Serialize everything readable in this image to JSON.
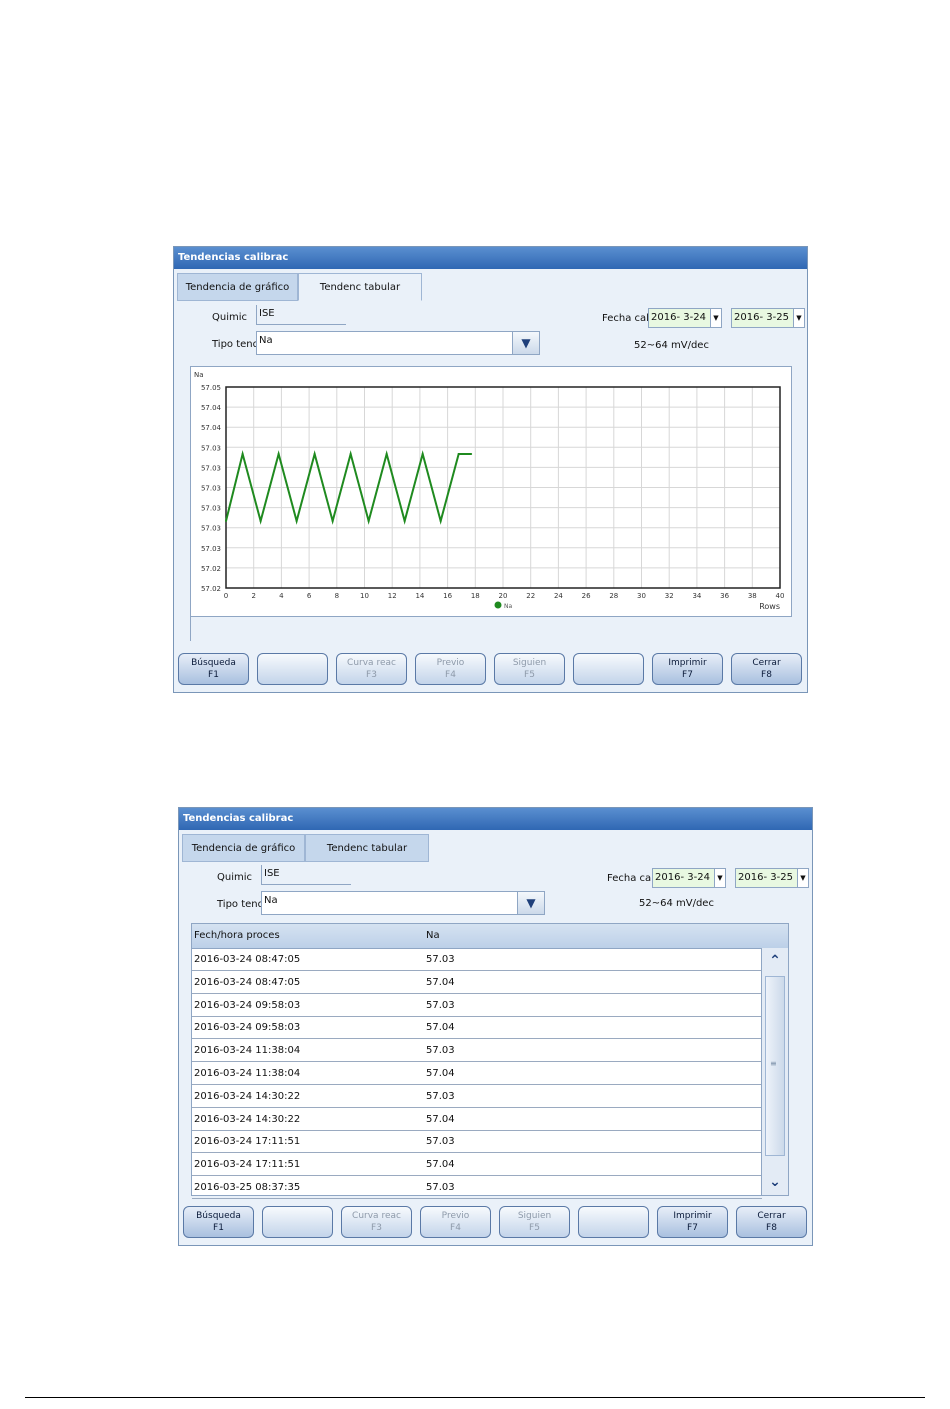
{
  "window_title": "Tendencias calibrac",
  "tabs": {
    "graph": "Tendencia de gráfico",
    "tabular": "Tendenc tabular"
  },
  "form": {
    "quimic_label": "Quimic",
    "quimic_value": "ISE",
    "tipo_label": "Tipo tend",
    "tipo_value": "Na",
    "fecha_label": "Fecha cal",
    "date_from": "2016- 3-24",
    "date_to": "2016- 3-25",
    "range_note": "52~64 mV/dec"
  },
  "buttons": [
    {
      "line1": "Búsqueda",
      "line2": "F1",
      "state": "primary"
    },
    {
      "line1": "",
      "line2": "",
      "state": "blank"
    },
    {
      "line1": "Curva reac",
      "line2": "F3",
      "state": "disabled"
    },
    {
      "line1": "Previo",
      "line2": "F4",
      "state": "disabled"
    },
    {
      "line1": "Siguien",
      "line2": "F5",
      "state": "disabled"
    },
    {
      "line1": "",
      "line2": "",
      "state": "blank"
    },
    {
      "line1": "Imprimir",
      "line2": "F7",
      "state": "primary"
    },
    {
      "line1": "Cerrar",
      "line2": "F8",
      "state": "primary"
    }
  ],
  "chart_data": {
    "type": "line",
    "ylabel": "Na",
    "xlabel": "Rows",
    "y_ticks": [
      "57.05",
      "57.04",
      "57.04",
      "57.03",
      "57.03",
      "57.03",
      "57.03",
      "57.03",
      "57.03",
      "57.02",
      "57.02"
    ],
    "x_ticks": [
      "0",
      "2",
      "4",
      "6",
      "8",
      "10",
      "12",
      "14",
      "16",
      "18",
      "20",
      "22",
      "24",
      "26",
      "28",
      "30",
      "32",
      "34",
      "36",
      "38",
      "40"
    ],
    "ylim": [
      57.02,
      57.05
    ],
    "xlim": [
      0,
      40
    ],
    "series": [
      {
        "name": "",
        "color": "#1f8a1f",
        "x": [
          0,
          1.2,
          2.5,
          3.8,
          5.1,
          6.4,
          7.7,
          9.0,
          10.3,
          11.6,
          12.9,
          14.2,
          15.5,
          16.8,
          17.7
        ],
        "values": [
          57.03,
          57.04,
          57.03,
          57.04,
          57.03,
          57.04,
          57.03,
          57.04,
          57.03,
          57.04,
          57.03,
          57.04,
          57.03,
          57.04,
          57.04
        ]
      }
    ],
    "legend": {
      "label": "Na",
      "placement": "bottom-center"
    },
    "grid": true
  },
  "table": {
    "headers": {
      "datetime": "Fech/hora proces",
      "value": "Na"
    },
    "rows": [
      {
        "datetime": "2016-03-24 08:47:05",
        "value": "57.03"
      },
      {
        "datetime": "2016-03-24 08:47:05",
        "value": "57.04"
      },
      {
        "datetime": "2016-03-24 09:58:03",
        "value": "57.03"
      },
      {
        "datetime": "2016-03-24 09:58:03",
        "value": "57.04"
      },
      {
        "datetime": "2016-03-24 11:38:04",
        "value": "57.03"
      },
      {
        "datetime": "2016-03-24 11:38:04",
        "value": "57.04"
      },
      {
        "datetime": "2016-03-24 14:30:22",
        "value": "57.03"
      },
      {
        "datetime": "2016-03-24 14:30:22",
        "value": "57.04"
      },
      {
        "datetime": "2016-03-24 17:11:51",
        "value": "57.03"
      },
      {
        "datetime": "2016-03-24 17:11:51",
        "value": "57.04"
      },
      {
        "datetime": "2016-03-25 08:37:35",
        "value": "57.03"
      }
    ]
  },
  "colors": {
    "title_bar": "#2f67b3",
    "series": "#1f8a1f",
    "date_bg": "#e8f8e1"
  }
}
